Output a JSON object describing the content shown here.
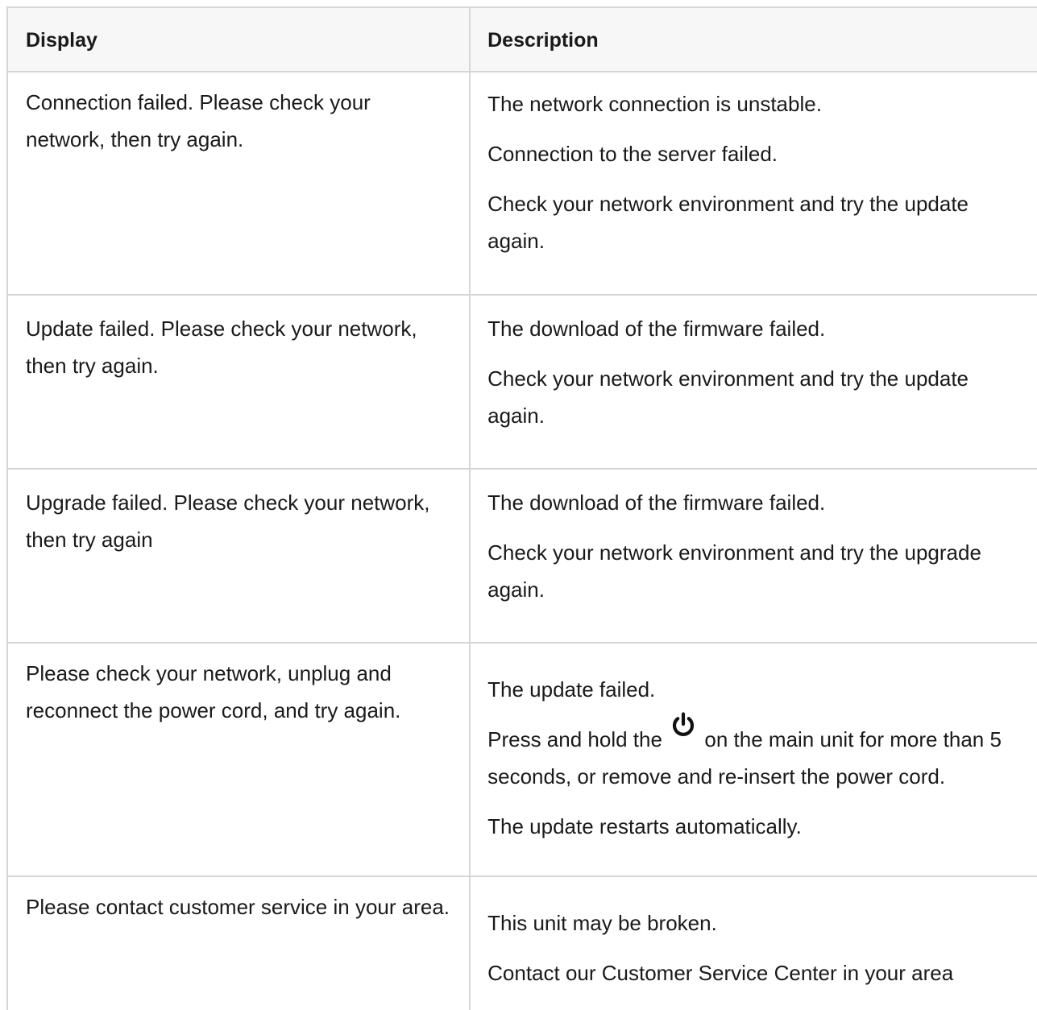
{
  "table": {
    "headers": {
      "display": "Display",
      "description": "Description"
    },
    "rows": [
      {
        "display": "Connection failed. Please check your network, then try again.",
        "description": [
          "The network connection is unstable.",
          "Connection to the server failed.",
          "Check your network environment and try the update again."
        ]
      },
      {
        "display": "Update failed. Please check your network, then try again.",
        "description": [
          "The download of the firmware failed.",
          "Check your network environment and try the update again."
        ]
      },
      {
        "display": "Upgrade failed. Please check your network, then try again",
        "description": [
          "The download of the firmware failed.",
          "Check your network environment and try the upgrade again."
        ]
      },
      {
        "display": "Please check your network, unplug and reconnect the power cord, and try again.",
        "description": [
          "The update failed.",
          {
            "before_icon": "Press and hold the",
            "icon": "power-icon",
            "after_icon": "on the main unit for more than 5 seconds, or remove and re-insert the power cord."
          },
          "The update restarts automatically."
        ]
      },
      {
        "display": "Please contact customer service in your area.",
        "description": [
          "This unit may be broken.",
          "Contact our Customer Service Center in your area"
        ]
      }
    ]
  }
}
